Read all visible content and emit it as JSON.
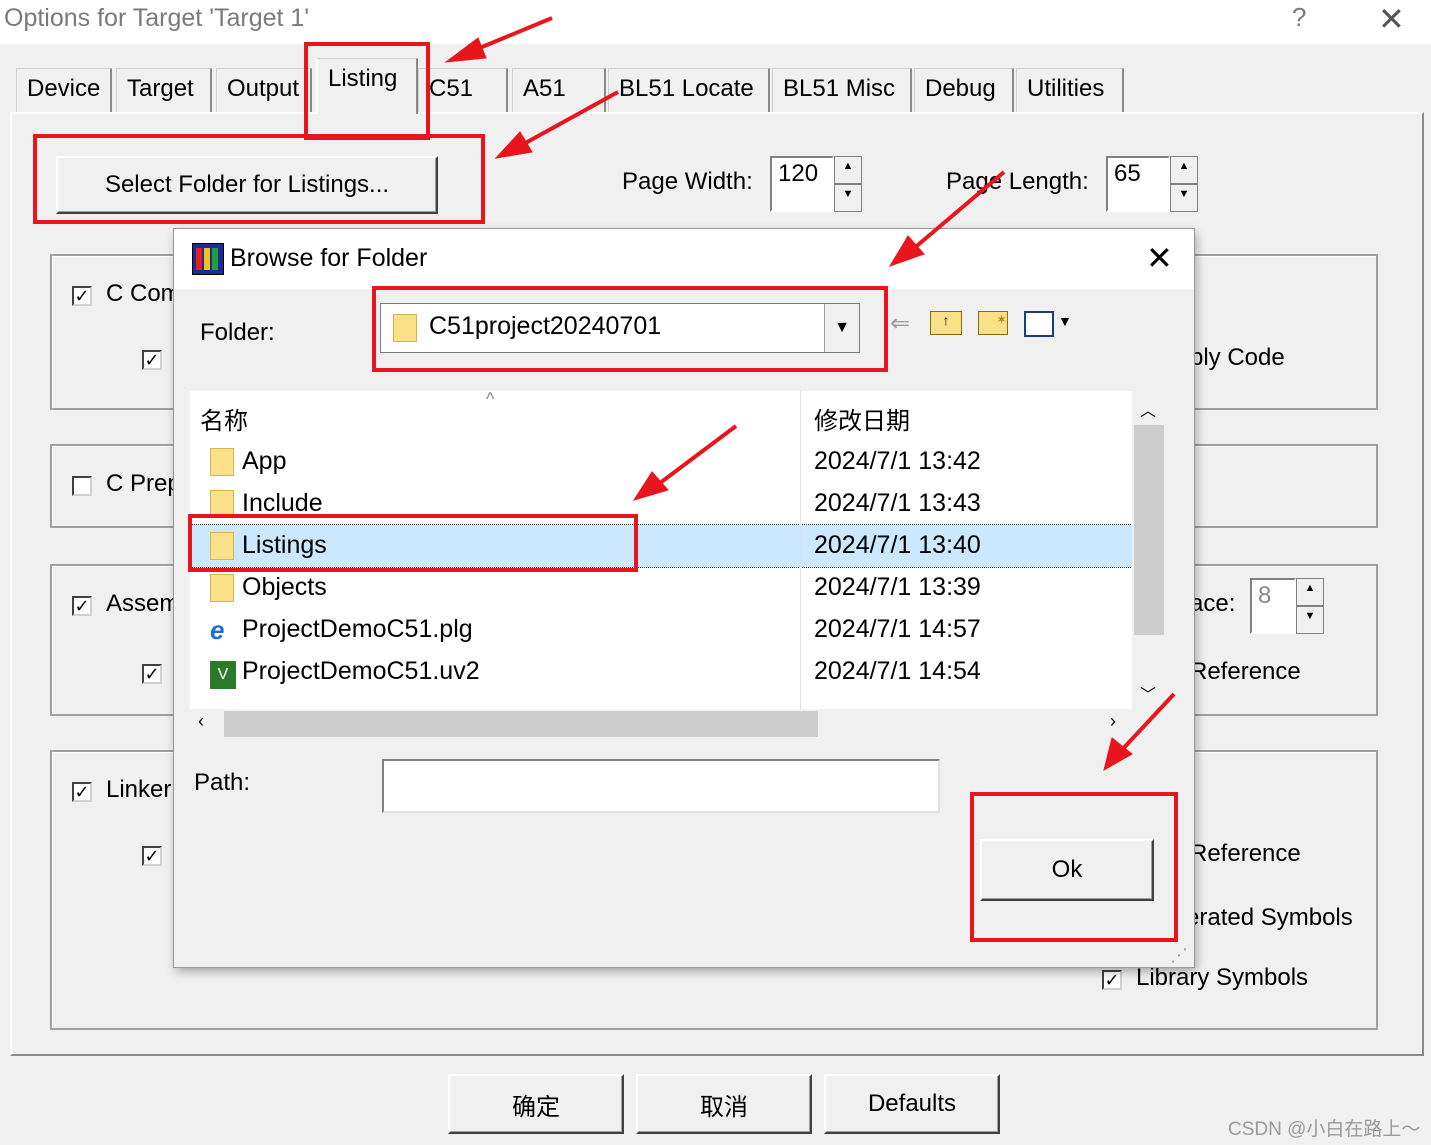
{
  "window": {
    "title": "Options for Target 'Target 1'",
    "help": "?",
    "close": "✕"
  },
  "tabs": [
    "Device",
    "Target",
    "Output",
    "Listing",
    "C51",
    "A51",
    "BL51 Locate",
    "BL51 Misc",
    "Debug",
    "Utilities"
  ],
  "listing": {
    "select_folder_label": "Select Folder for Listings...",
    "page_width_label": "Page Width:",
    "page_width_value": "120",
    "page_length_label": "Page Length:",
    "page_length_value": "65",
    "groups": {
      "c_compiler": "C Com",
      "c_preprocessor": "C Prep",
      "assembler": "Assem",
      "linker": "Linker"
    },
    "right_labels": {
      "assembly_code": "bly Code",
      "tab_space": "ace:",
      "tab_space_value": "8",
      "cross_reference_1": "Reference",
      "cross_reference_2": "Reference",
      "generated_symbols": "erated Symbols",
      "library_symbols": "Library Symbols"
    }
  },
  "dialog": {
    "title": "Browse for Folder",
    "close": "✕",
    "folder_label": "Folder:",
    "folder_value": "C51project20240701",
    "columns": {
      "name": "名称",
      "date": "修改日期"
    },
    "rows": [
      {
        "name": "App",
        "date": "2024/7/1 13:42",
        "icon": "folder-icon"
      },
      {
        "name": "Include",
        "date": "2024/7/1 13:43",
        "icon": "folder-icon"
      },
      {
        "name": "Listings",
        "date": "2024/7/1 13:40",
        "icon": "folder-icon",
        "selected": true
      },
      {
        "name": "Objects",
        "date": "2024/7/1 13:39",
        "icon": "folder-icon"
      },
      {
        "name": "ProjectDemoC51.plg",
        "date": "2024/7/1 14:57",
        "icon": "ie-file-icon"
      },
      {
        "name": "ProjectDemoC51.uv2",
        "date": "2024/7/1 14:54",
        "icon": "uvision-file-icon"
      }
    ],
    "path_label": "Path:",
    "path_value": "",
    "ok_label": "Ok"
  },
  "bottom_buttons": {
    "ok": "确定",
    "cancel": "取消",
    "defaults": "Defaults"
  },
  "watermark": "CSDN @小白在路上～",
  "colors": {
    "annotation_red": "#e8151c",
    "selection": "#cce8ff"
  }
}
